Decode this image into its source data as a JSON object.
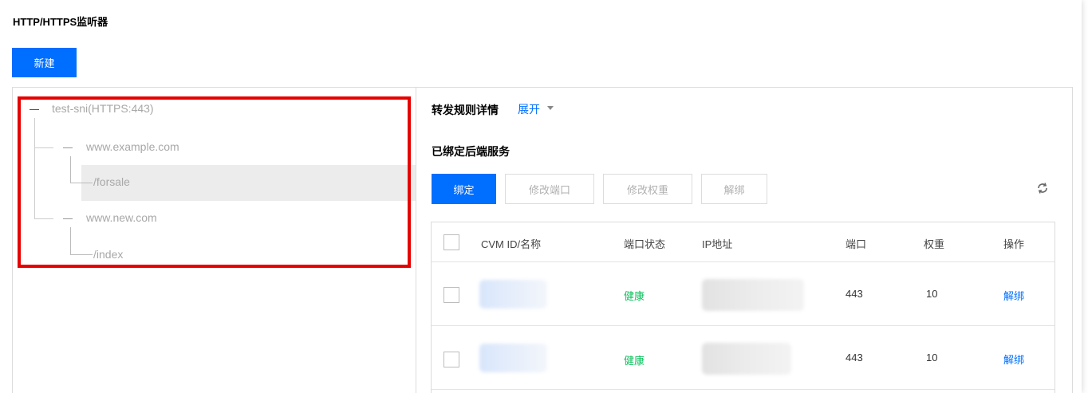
{
  "listener": {
    "title": "HTTP/HTTPS监听器",
    "new_button": "新建"
  },
  "tree": {
    "root_label": "test-sni(HTTPS:443)",
    "domains": [
      {
        "label": "www.example.com",
        "paths": [
          "/forsale"
        ]
      },
      {
        "label": "www.new.com",
        "paths": [
          "/index"
        ]
      }
    ],
    "selected_path": "/forsale"
  },
  "detail": {
    "rule_title": "转发规则详情",
    "expand_label": "展开",
    "bound_title": "已绑定后端服务"
  },
  "toolbar": {
    "bind": "绑定",
    "modify_port": "修改端口",
    "modify_weight": "修改权重",
    "unbind": "解绑"
  },
  "table": {
    "headers": [
      "CVM ID/名称",
      "端口状态",
      "IP地址",
      "端口",
      "权重",
      "操作"
    ],
    "rows": [
      {
        "status": "健康",
        "port": "443",
        "weight": "10",
        "action": "解绑"
      },
      {
        "status": "健康",
        "port": "443",
        "weight": "10",
        "action": "解绑"
      }
    ]
  },
  "colors": {
    "primary": "#006eff",
    "highlight_border": "#e60000",
    "healthy": "#0abf5b"
  },
  "icons": [
    "refresh-icon"
  ]
}
